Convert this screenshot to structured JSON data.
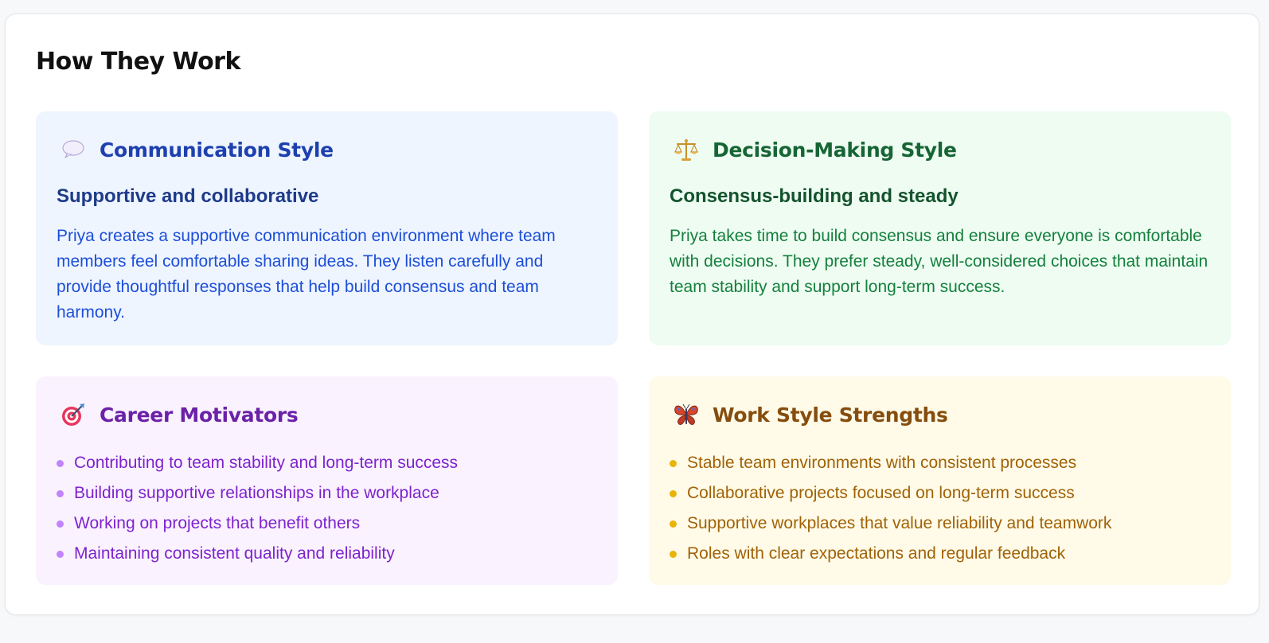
{
  "section": {
    "title": "How They Work"
  },
  "cards": {
    "communication": {
      "icon": "speech-bubble-icon",
      "title": "Communication Style",
      "subtitle": "Supportive and collaborative",
      "text": "Priya creates a supportive communication environment where team members feel comfortable sharing ideas. They listen carefully and provide thoughtful responses that help build consensus and team harmony."
    },
    "decision": {
      "icon": "balance-scale-icon",
      "title": "Decision-Making Style",
      "subtitle": "Consensus-building and steady",
      "text": "Priya takes time to build consensus and ensure everyone is comfortable with decisions. They prefer steady, well-considered choices that maintain team stability and support long-term success."
    },
    "motivators": {
      "icon": "target-icon",
      "title": "Career Motivators",
      "items": [
        "Contributing to team stability and long-term success",
        "Building supportive relationships in the workplace",
        "Working on projects that benefit others",
        "Maintaining consistent quality and reliability"
      ]
    },
    "strengths": {
      "icon": "butterfly-icon",
      "title": "Work Style Strengths",
      "items": [
        "Stable team environments with consistent processes",
        "Collaborative projects focused on long-term success",
        "Supportive workplaces that value reliability and teamwork",
        "Roles with clear expectations and regular feedback"
      ]
    }
  },
  "colors": {
    "communication_bg": "#eef5ff",
    "decision_bg": "#eefcf2",
    "motivators_bg": "#faf3ff",
    "strengths_bg": "#fffbe8"
  }
}
